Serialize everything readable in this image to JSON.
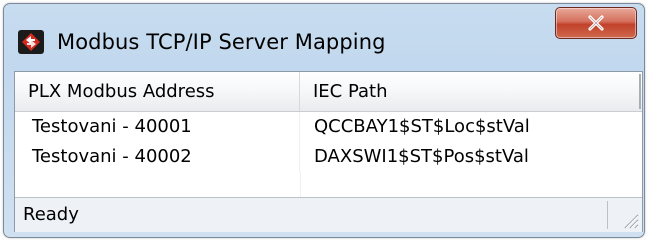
{
  "window": {
    "title": "Modbus TCP/IP Server Mapping",
    "close_glyph": "✕",
    "app_icon": "red-diamond-arrows-icon"
  },
  "table": {
    "columns": [
      "PLX Modbus Address",
      "IEC Path"
    ],
    "rows": [
      {
        "address": "Testovani - 40001",
        "iec_path": "QCCBAY1$ST$Loc$stVal"
      },
      {
        "address": "Testovani - 40002",
        "iec_path": "DAXSWI1$ST$Pos$stVal"
      }
    ]
  },
  "status": {
    "text": "Ready"
  },
  "colors": {
    "close_button": "#c2412a",
    "title_bar": "#c7dcef",
    "icon_red": "#d42a20"
  }
}
